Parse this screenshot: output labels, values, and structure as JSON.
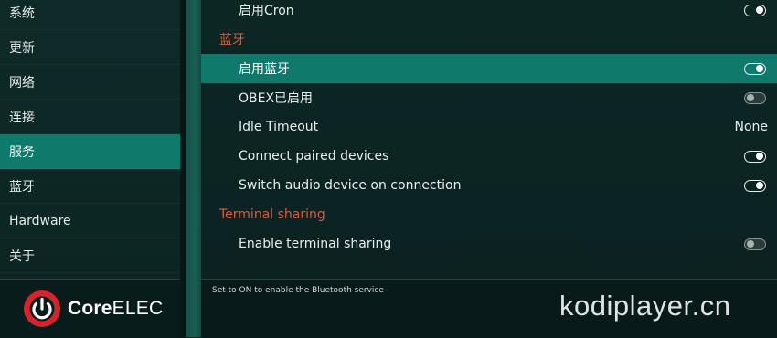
{
  "sidebar": {
    "items": [
      {
        "label": "系统",
        "active": false
      },
      {
        "label": "更新",
        "active": false
      },
      {
        "label": "网络",
        "active": false
      },
      {
        "label": "连接",
        "active": false
      },
      {
        "label": "服务",
        "active": true
      },
      {
        "label": "蓝牙",
        "active": false
      },
      {
        "label": "Hardware",
        "active": false
      },
      {
        "label": "关于",
        "active": false
      }
    ]
  },
  "main": {
    "rows": [
      {
        "label": "启用Cron",
        "control": "toggle",
        "state": "on"
      },
      {
        "section": "蓝牙"
      },
      {
        "label": "启用蓝牙",
        "control": "toggle",
        "state": "on",
        "focused": true
      },
      {
        "label": "OBEX已启用",
        "control": "toggle",
        "state": "off"
      },
      {
        "label": "Idle Timeout",
        "control": "value",
        "value": "None"
      },
      {
        "label": "Connect paired devices",
        "control": "toggle",
        "state": "on"
      },
      {
        "label": "Switch audio device on connection",
        "control": "toggle",
        "state": "on"
      },
      {
        "section": "Terminal sharing"
      },
      {
        "label": "Enable terminal sharing",
        "control": "toggle",
        "state": "off"
      }
    ]
  },
  "footer": {
    "hint": "Set to ON to enable the Bluetooth service",
    "logo_text_bold": "Core",
    "logo_text_regular": "ELEC",
    "watermark": "kodiplayer.cn"
  },
  "colors": {
    "accent": "#0f7a6c",
    "section_header": "#e1583a",
    "background": "#0b2321",
    "logo_red": "#d8232a"
  },
  "icons": {
    "logo": "power-icon"
  }
}
